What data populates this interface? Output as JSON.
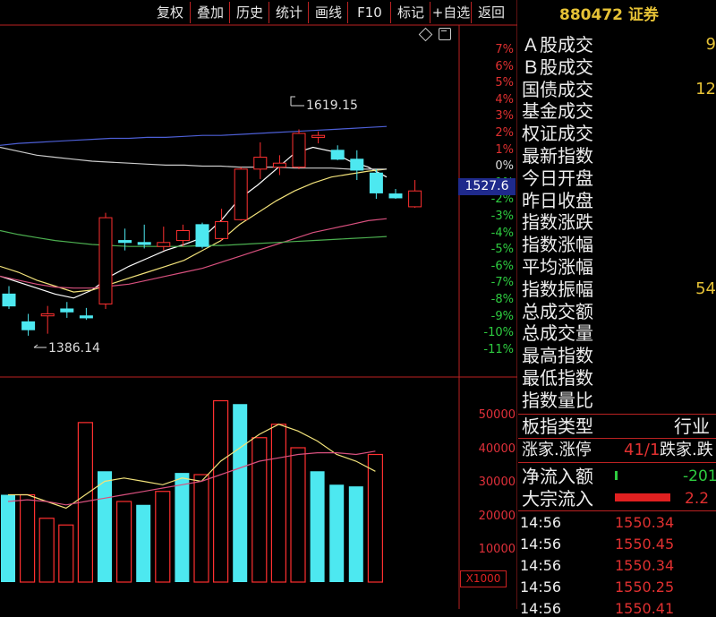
{
  "toolbar": {
    "buttons": [
      "复权",
      "叠加",
      "历史",
      "统计",
      "画线",
      "F10",
      "标记",
      "+自选",
      "返回"
    ]
  },
  "chart_data": [
    {
      "type": "candlestick",
      "y_labels": [
        "7%",
        "6%",
        "5%",
        "4%",
        "3%",
        "2%",
        "1%",
        "0%",
        "-1%",
        "-2%",
        "-3%",
        "-4%",
        "-5%",
        "-6%",
        "-7%",
        "-8%",
        "-9%",
        "-10%",
        "-11%"
      ],
      "ylim": [
        1386.14,
        1619.15
      ],
      "current_price": "1527.6",
      "high_annotation": "1619.15",
      "low_annotation": "1386.14",
      "candles": [
        {
          "o": 1440,
          "h": 1448,
          "l": 1425,
          "c": 1428
        },
        {
          "o": 1412,
          "h": 1420,
          "l": 1398,
          "c": 1404
        },
        {
          "o": 1418,
          "h": 1428,
          "l": 1400,
          "c": 1420
        },
        {
          "o": 1425,
          "h": 1432,
          "l": 1416,
          "c": 1422
        },
        {
          "o": 1418,
          "h": 1426,
          "l": 1414,
          "c": 1416
        },
        {
          "o": 1430,
          "h": 1522,
          "l": 1425,
          "c": 1517
        },
        {
          "o": 1494,
          "h": 1506,
          "l": 1484,
          "c": 1492
        },
        {
          "o": 1492,
          "h": 1510,
          "l": 1486,
          "c": 1490
        },
        {
          "o": 1488,
          "h": 1508,
          "l": 1484,
          "c": 1492
        },
        {
          "o": 1494,
          "h": 1510,
          "l": 1488,
          "c": 1504
        },
        {
          "o": 1510,
          "h": 1512,
          "l": 1486,
          "c": 1488
        },
        {
          "o": 1496,
          "h": 1526,
          "l": 1494,
          "c": 1513
        },
        {
          "o": 1515,
          "h": 1568,
          "l": 1514,
          "c": 1566
        },
        {
          "o": 1566,
          "h": 1593,
          "l": 1556,
          "c": 1578
        },
        {
          "o": 1568,
          "h": 1580,
          "l": 1560,
          "c": 1572
        },
        {
          "o": 1568,
          "h": 1606,
          "l": 1566,
          "c": 1602
        },
        {
          "o": 1598,
          "h": 1604,
          "l": 1592,
          "c": 1600
        },
        {
          "o": 1585,
          "h": 1590,
          "l": 1575,
          "c": 1576
        },
        {
          "o": 1576,
          "h": 1585,
          "l": 1555,
          "c": 1565
        },
        {
          "o": 1562,
          "h": 1566,
          "l": 1536,
          "c": 1542
        },
        {
          "o": 1541,
          "h": 1546,
          "l": 1536,
          "c": 1537
        },
        {
          "o": 1528,
          "h": 1555,
          "l": 1527,
          "c": 1544
        }
      ],
      "ma_lines": [
        {
          "color": "#ffffff",
          "values": [
            1458,
            1452,
            1446,
            1440,
            1436,
            1444,
            1458,
            1468,
            1476,
            1484,
            1490,
            1497,
            1514,
            1536,
            1550,
            1566,
            1582,
            1588,
            1584,
            1574,
            1568,
            1558
          ]
        },
        {
          "color": "#f2e27a",
          "values": [
            1468,
            1462,
            1454,
            1448,
            1442,
            1444,
            1450,
            1456,
            1462,
            1468,
            1474,
            1484,
            1494,
            1510,
            1522,
            1534,
            1544,
            1552,
            1558,
            1561,
            1564,
            1566
          ]
        },
        {
          "color": "#d8507e",
          "values": [
            1458,
            1454,
            1450,
            1447,
            1446,
            1446,
            1448,
            1450,
            1454,
            1458,
            1462,
            1466,
            1472,
            1478,
            1484,
            1490,
            1496,
            1502,
            1506,
            1510,
            1514,
            1516
          ]
        },
        {
          "color": "#4caf50",
          "values": [
            1504,
            1500,
            1497,
            1494,
            1492,
            1490,
            1489,
            1488,
            1488,
            1488,
            1488,
            1489,
            1489,
            1490,
            1491,
            1492,
            1493,
            1494,
            1495,
            1496,
            1497,
            1498
          ]
        },
        {
          "color": "#4d5fd6",
          "values": [
            1590,
            1592,
            1593,
            1594,
            1595,
            1596,
            1597,
            1597,
            1598,
            1598,
            1599,
            1600,
            1600,
            1601,
            1602,
            1603,
            1604,
            1605,
            1606,
            1607,
            1608,
            1609
          ]
        },
        {
          "color": "#cccccc",
          "values": [
            1588,
            1584,
            1580,
            1578,
            1576,
            1574,
            1573,
            1572,
            1571,
            1570,
            1570,
            1569,
            1569,
            1568,
            1568,
            1568,
            1567,
            1567,
            1567,
            1566,
            1566,
            1566
          ]
        }
      ]
    },
    {
      "type": "bar",
      "y_labels": [
        "50000",
        "40000",
        "30000",
        "20000",
        "10000"
      ],
      "unit": "X1000",
      "ylim": [
        0,
        50000
      ],
      "bars": [
        {
          "v": 26000,
          "c": "cyan"
        },
        {
          "v": 26000,
          "c": "red"
        },
        {
          "v": 19000,
          "c": "red"
        },
        {
          "v": 17000,
          "c": "red"
        },
        {
          "v": 47500,
          "c": "red"
        },
        {
          "v": 33000,
          "c": "cyan"
        },
        {
          "v": 24000,
          "c": "red"
        },
        {
          "v": 23000,
          "c": "cyan"
        },
        {
          "v": 27000,
          "c": "red"
        },
        {
          "v": 32500,
          "c": "cyan"
        },
        {
          "v": 32000,
          "c": "red"
        },
        {
          "v": 54000,
          "c": "red"
        },
        {
          "v": 53000,
          "c": "cyan"
        },
        {
          "v": 43000,
          "c": "red"
        },
        {
          "v": 47000,
          "c": "red"
        },
        {
          "v": 40000,
          "c": "red"
        },
        {
          "v": 33000,
          "c": "cyan"
        },
        {
          "v": 29000,
          "c": "cyan"
        },
        {
          "v": 28500,
          "c": "cyan"
        },
        {
          "v": 38000,
          "c": "red"
        }
      ],
      "ma_lines": [
        {
          "color": "#f2e27a",
          "values": [
            26000,
            26000,
            24000,
            22000,
            26000,
            30000,
            31000,
            30000,
            29000,
            31000,
            30000,
            36000,
            40000,
            44000,
            47000,
            45000,
            42000,
            38000,
            36000,
            33000
          ]
        },
        {
          "color": "#d8507e",
          "values": [
            24000,
            24500,
            24000,
            23000,
            24000,
            25000,
            26000,
            27000,
            28000,
            29000,
            30000,
            32000,
            34000,
            36000,
            37000,
            38000,
            38500,
            38500,
            38000,
            39000
          ]
        }
      ]
    }
  ],
  "right_panel": {
    "title": "880472 证券",
    "fields": [
      {
        "label": "Ａ股成交",
        "value": "9"
      },
      {
        "label": "Ｂ股成交",
        "value": ""
      },
      {
        "label": "国债成交",
        "value": "12"
      },
      {
        "label": "基金成交",
        "value": ""
      },
      {
        "label": "权证成交",
        "value": ""
      },
      {
        "label": "最新指数",
        "value": ""
      },
      {
        "label": "今日开盘",
        "value": ""
      },
      {
        "label": "昨日收盘",
        "value": ""
      },
      {
        "label": "指数涨跌",
        "value": ""
      },
      {
        "label": "指数涨幅",
        "value": ""
      },
      {
        "label": "平均涨幅",
        "value": ""
      },
      {
        "label": "指数振幅",
        "value": "54"
      },
      {
        "label": "总成交额",
        "value": ""
      },
      {
        "label": "总成交量",
        "value": ""
      },
      {
        "label": "最高指数",
        "value": ""
      },
      {
        "label": "最低指数",
        "value": ""
      },
      {
        "label": "指数量比",
        "value": ""
      }
    ],
    "board_type_label": "板指类型",
    "board_type_value": "行业",
    "up_down_label": "涨家.涨停",
    "up_down_value": "41/1",
    "down_label": "跌家.跌",
    "net_inflow_label": "净流入额",
    "net_inflow_value": "-201",
    "block_inflow_label": "大宗流入",
    "block_inflow_value": "2.2",
    "ticks": [
      {
        "time": "14:56",
        "price": "1550.34"
      },
      {
        "time": "14:56",
        "price": "1550.45"
      },
      {
        "time": "14:56",
        "price": "1550.34"
      },
      {
        "time": "14:56",
        "price": "1550.25"
      },
      {
        "time": "14:56",
        "price": "1550.41"
      }
    ]
  }
}
